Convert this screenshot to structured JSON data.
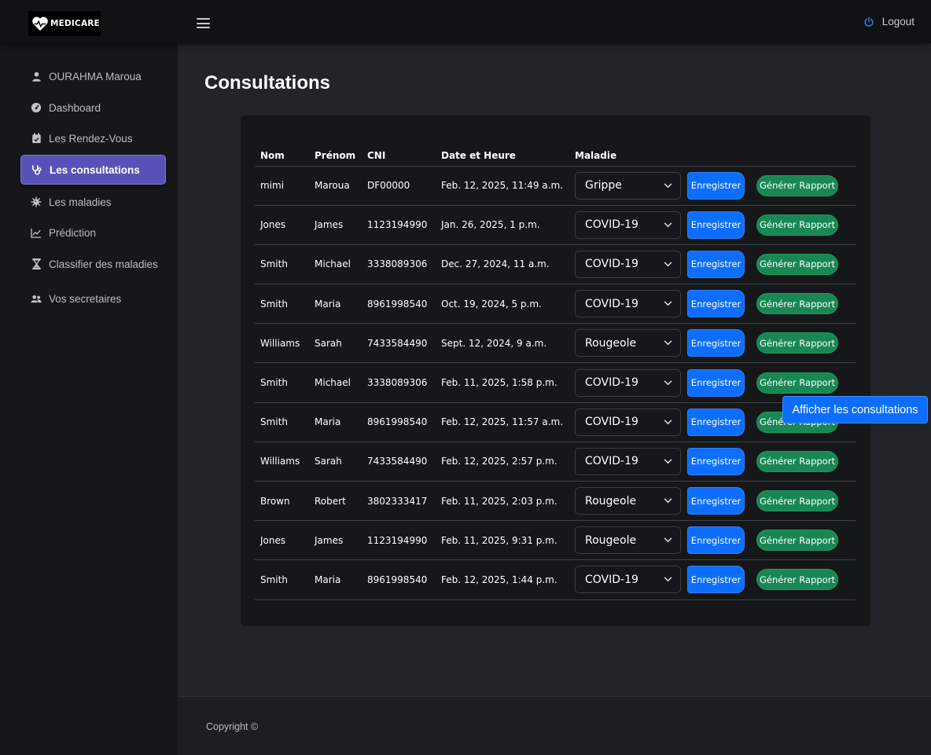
{
  "brand": {
    "name": "MEDICARE",
    "icon": "heart-pulse-icon"
  },
  "header": {
    "menu_icon": "hamburger-icon",
    "logout_label": "Logout",
    "logout_icon": "power-icon"
  },
  "sidebar": {
    "items": [
      {
        "label": "OURAHMA Maroua",
        "icon": "user-icon"
      },
      {
        "label": "Dashboard",
        "icon": "dashboard-gauge-icon"
      },
      {
        "label": "Les Rendez-Vous",
        "icon": "calendar-check-icon"
      },
      {
        "label": "Les consultations",
        "icon": "stethoscope-icon",
        "active": true
      },
      {
        "label": "Les maladies",
        "icon": "virus-icon"
      },
      {
        "label": "Prédiction",
        "icon": "line-chart-icon"
      },
      {
        "label": "Classifier des maladies",
        "icon": "hourglass-icon"
      },
      {
        "label": "Vos secretaires",
        "icon": "users-icon"
      }
    ]
  },
  "page": {
    "title": "Consultations"
  },
  "table": {
    "headers": [
      "Nom",
      "Prénom",
      "CNI",
      "Date et Heure",
      "Maladie"
    ],
    "save_label": "Enregistrer",
    "report_label": "Générer Rapport",
    "rows": [
      {
        "nom": "mimi",
        "prenom": "Maroua",
        "cni": "DF00000",
        "date": "Feb. 12, 2025, 11:49 a.m.",
        "maladie": "Grippe"
      },
      {
        "nom": "Jones",
        "prenom": "James",
        "cni": "1123194990",
        "date": "Jan. 26, 2025, 1 p.m.",
        "maladie": "COVID-19"
      },
      {
        "nom": "Smith",
        "prenom": "Michael",
        "cni": "3338089306",
        "date": "Dec. 27, 2024, 11 a.m.",
        "maladie": "COVID-19"
      },
      {
        "nom": "Smith",
        "prenom": "Maria",
        "cni": "8961998540",
        "date": "Oct. 19, 2024, 5 p.m.",
        "maladie": "COVID-19"
      },
      {
        "nom": "Williams",
        "prenom": "Sarah",
        "cni": "7433584490",
        "date": "Sept. 12, 2024, 9 a.m.",
        "maladie": "Rougeole"
      },
      {
        "nom": "Smith",
        "prenom": "Michael",
        "cni": "3338089306",
        "date": "Feb. 11, 2025, 1:58 p.m.",
        "maladie": "COVID-19"
      },
      {
        "nom": "Smith",
        "prenom": "Maria",
        "cni": "8961998540",
        "date": "Feb. 12, 2025, 11:57 a.m.",
        "maladie": "COVID-19"
      },
      {
        "nom": "Williams",
        "prenom": "Sarah",
        "cni": "7433584490",
        "date": "Feb. 12, 2025, 2:57 p.m.",
        "maladie": "COVID-19"
      },
      {
        "nom": "Brown",
        "prenom": "Robert",
        "cni": "3802333417",
        "date": "Feb. 11, 2025, 2:03 p.m.",
        "maladie": "Rougeole"
      },
      {
        "nom": "Jones",
        "prenom": "James",
        "cni": "1123194990",
        "date": "Feb. 11, 2025, 9:31 p.m.",
        "maladie": "Rougeole"
      },
      {
        "nom": "Smith",
        "prenom": "Maria",
        "cni": "8961998540",
        "date": "Feb. 12, 2025, 1:44 p.m.",
        "maladie": "COVID-19"
      }
    ]
  },
  "tooltip": {
    "text": "Afficher les consultations"
  },
  "footer": {
    "copyright": "Copyright ©"
  },
  "colors": {
    "primary": "#0d6efd",
    "success": "#198754",
    "active_nav": "#5852b8"
  }
}
